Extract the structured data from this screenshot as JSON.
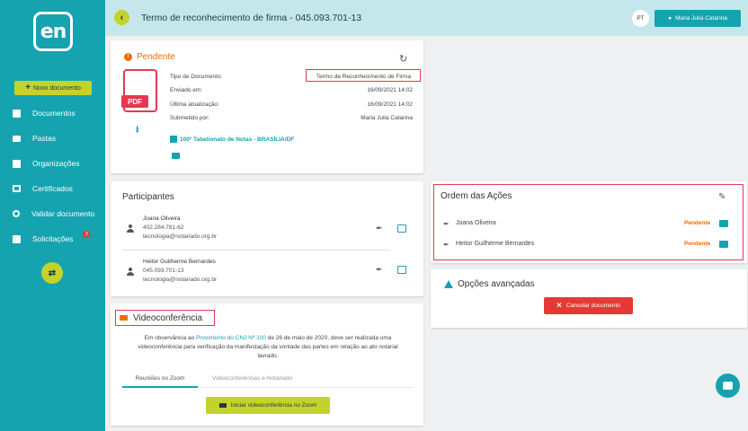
{
  "sidebar": {
    "logo_text": "en",
    "new_document_label": "Novo documento",
    "items": [
      {
        "label": "Documentos",
        "icon": "document-icon"
      },
      {
        "label": "Pastas",
        "icon": "folder-icon"
      },
      {
        "label": "Organizações",
        "icon": "organization-icon"
      },
      {
        "label": "Certificados",
        "icon": "certificate-icon"
      },
      {
        "label": "Validar documento",
        "icon": "search-icon"
      },
      {
        "label": "Solicitações",
        "icon": "request-icon",
        "badge": "2"
      }
    ]
  },
  "header": {
    "title": "Termo de reconhecimento de firma - 045.093.701-13",
    "avatar_initials": "PT",
    "user_name": "Maria Julia Catarina"
  },
  "document": {
    "status": "Pendente",
    "pdf_label": "PDF",
    "fields": [
      {
        "key": "Tipo de Documento:",
        "value": "Termo de Reconhecimento de Firma"
      },
      {
        "key": "Enviado em:",
        "value": "16/09/2021 14:02"
      },
      {
        "key": "Última atualização:",
        "value": "16/09/2021 14:02"
      },
      {
        "key": "Submetido por:",
        "value": "Maria Julia Catarina"
      }
    ],
    "office": "100º Tabelionato de Notas - BRASÍLIA/DF"
  },
  "participants": {
    "title": "Participantes",
    "people": [
      {
        "name": "Joana Oliveira",
        "cpf": "402.284.781-62",
        "email": "tecnologia@notariado.org.br"
      },
      {
        "name": "Heitor Guilherme Bernardes",
        "cpf": "045.093.701-13",
        "email": "tecnologia@notariado.org.br"
      }
    ]
  },
  "video": {
    "title": "Videoconferência",
    "text_before": "Em observância ao ",
    "link": "Provimento do CNJ Nº 100",
    "text_after": " de 26 de maio de 2020, deve ser realizada uma videoconferência para verificação da manifestação da vontade das partes em relação ao ato notarial lavrado.",
    "tab_active": "Reuniões no Zoom",
    "tab_inactive": "Videoconferências e-Notariado",
    "button": "Iniciar videoconferência no Zoom"
  },
  "order": {
    "title": "Ordem das Ações",
    "rows": [
      {
        "name": "Joana Oliveira",
        "status": "Pendente"
      },
      {
        "name": "Heitor Guilherme Bernardes",
        "status": "Pendente"
      }
    ]
  },
  "advanced": {
    "title": "Opções avançadas",
    "cancel_label": "Cancelar documento"
  },
  "colors": {
    "sidebar": "#15a3b0",
    "accent": "#c4d22c",
    "pending": "#ef6c00",
    "danger": "#e53935"
  }
}
